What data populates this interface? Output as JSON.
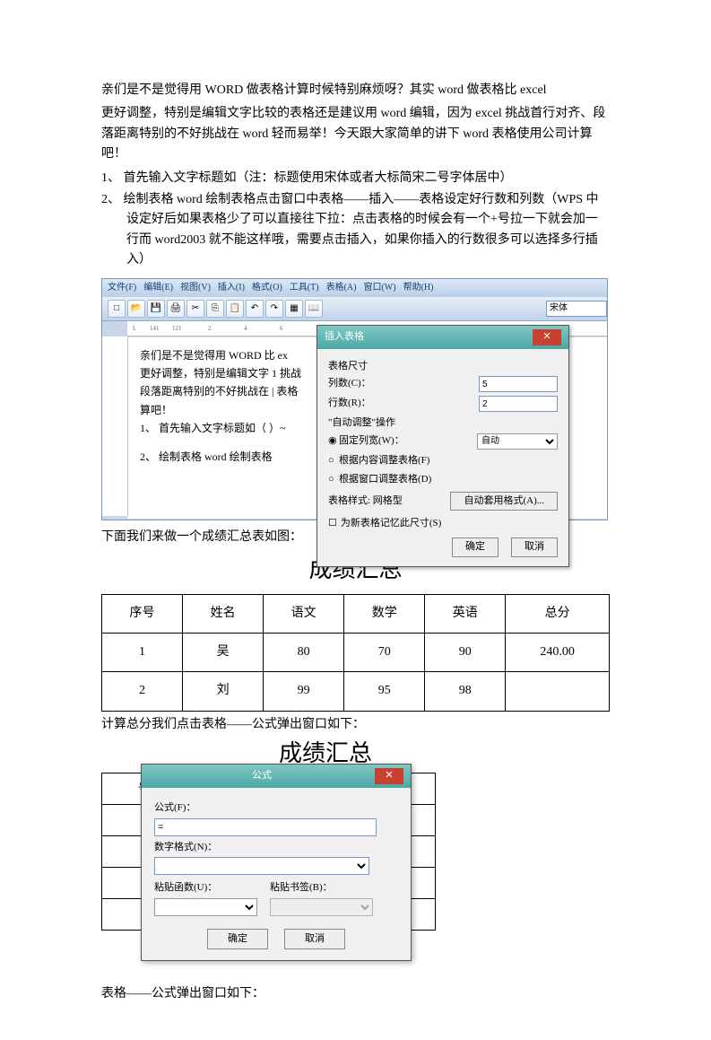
{
  "intro1": "亲们是不是觉得用 WORD 做表格计算时候特别麻烦呀？其实 word 做表格比 excel",
  "intro2": "更好调整，特别是编辑文字比较的表格还是建议用 word 编辑，因为 excel 挑战首行对齐、段落距离特别的不好挑战在 word 轻而易举！今天跟大家简单的讲下 word 表格使用公司计算吧！",
  "item1": "1、 首先输入文字标题如（注：标题使用宋体或者大标简宋二号字体居中）",
  "item2": "2、 绘制表格 word 绘制表格点击窗口中表格——插入——表格设定好行数和列数（WPS 中设定好后如果表格少了可以直接往下拉：点击表格的时候会有一个+号拉一下就会加一行而 word2003 就不能这样哦，需要点击插入，如果你插入的行数很多可以选择多行插入）",
  "menubar": {
    "file": "文件(F)",
    "edit": "编辑(E)",
    "view": "视图(V)",
    "insert": "插入(I)",
    "format": "格式(O)",
    "tools": "工具(T)",
    "table": "表格(A)",
    "window": "窗口(W)",
    "help": "帮助(H)"
  },
  "fontbox": "宋体",
  "doc_line1": "亲们是不是觉得用 WORD                                                                    比 ex",
  "doc_line2": "更好调整，特别是编辑文字                                                                  1 挑战",
  "doc_line3": "段落距离特别的不好挑战在                                                                  | 表格",
  "doc_line4": "算吧！",
  "doc_line5": "1、 首先输入文字标题如（                                                                  ）~",
  "doc_line6": "2、 绘制表格 word 绘制表格",
  "dialog1": {
    "title": "插入表格",
    "size": "表格尺寸",
    "cols": "列数(C)：",
    "rows": "行数(R)：",
    "cols_val": "5",
    "rows_val": "2",
    "autofit": "\"自动调整\"操作",
    "r1": "固定列宽(W)：",
    "r1_val": "自动",
    "r2": "根据内容调整表格(F)",
    "r3": "根据窗口调整表格(D)",
    "style": "表格样式: 网格型",
    "autofmt": "自动套用格式(A)...",
    "remember": "为新表格记忆此尺寸(S)",
    "ok": "确定",
    "cancel": "取消"
  },
  "below_text": "下面我们来做一个成绩汇总表如图：",
  "score_title": "成绩汇总",
  "table_headers": [
    "序号",
    "姓名",
    "语文",
    "数学",
    "英语",
    "总分"
  ],
  "rows": [
    [
      "1",
      "吴",
      "80",
      "70",
      "90",
      "240.00"
    ],
    [
      "2",
      "刘",
      "99",
      "95",
      "98",
      ""
    ]
  ],
  "calc_text": "计算总分我们点击表格——公式弹出窗口如下：",
  "score_title2": "成绩汇总",
  "formula_dialog": {
    "title": "公式",
    "formula": "公式(F)：",
    "formula_val": "=",
    "numfmt": "数字格式(N)：",
    "paste_fn": "粘贴函数(U)：",
    "paste_bm": "粘贴书签(B)：",
    "ok": "确定",
    "cancel": "取消"
  },
  "behind": "表格——公式弹出窗口如下："
}
